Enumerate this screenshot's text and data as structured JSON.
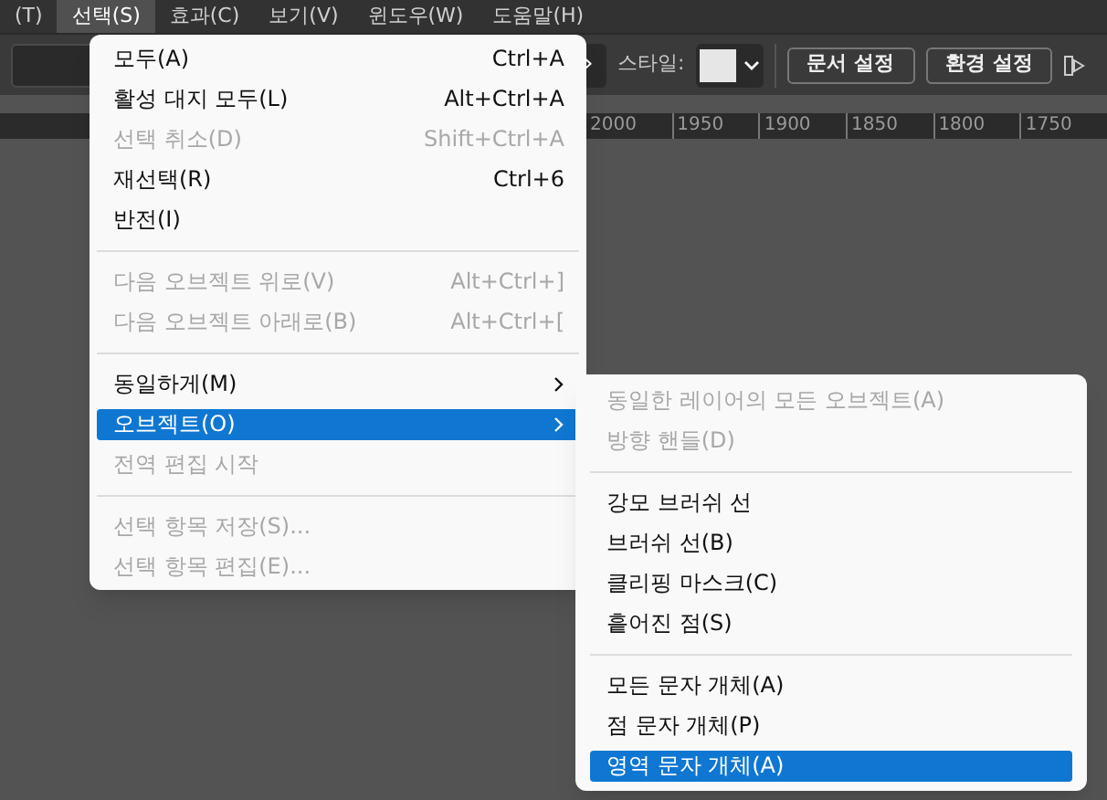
{
  "menu_bar": [
    {
      "label": "(T)",
      "selected": false
    },
    {
      "label": "선택(S)",
      "selected": true
    },
    {
      "label": "효과(C)",
      "selected": false
    },
    {
      "label": "보기(V)",
      "selected": false
    },
    {
      "label": "윈도우(W)",
      "selected": false
    },
    {
      "label": "도움말(H)",
      "selected": false
    }
  ],
  "toolbar": {
    "next_button": "›",
    "style_label": "스타일:",
    "buttons": [
      "문서 설정",
      "환경 설정"
    ]
  },
  "ruler": {
    "labels": [
      "2000",
      "1950",
      "1900",
      "1850",
      "1800",
      "1750"
    ]
  },
  "menu": [
    {
      "kind": "item",
      "label": "모두(A)",
      "shortcut": "Ctrl+A",
      "disabled": false,
      "selected": false,
      "submenu": false
    },
    {
      "kind": "item",
      "label": "활성 대지 모두(L)",
      "shortcut": "Alt+Ctrl+A",
      "disabled": false,
      "selected": false,
      "submenu": false
    },
    {
      "kind": "item",
      "label": "선택 취소(D)",
      "shortcut": "Shift+Ctrl+A",
      "disabled": true,
      "selected": false,
      "submenu": false
    },
    {
      "kind": "item",
      "label": "재선택(R)",
      "shortcut": "Ctrl+6",
      "disabled": false,
      "selected": false,
      "submenu": false
    },
    {
      "kind": "item",
      "label": "반전(I)",
      "disabled": false,
      "selected": false,
      "submenu": false
    },
    {
      "kind": "separator"
    },
    {
      "kind": "item",
      "label": "다음 오브젝트 위로(V)",
      "shortcut": "Alt+Ctrl+]",
      "disabled": true,
      "selected": false,
      "submenu": false
    },
    {
      "kind": "item",
      "label": "다음 오브젝트 아래로(B)",
      "shortcut": "Alt+Ctrl+[",
      "disabled": true,
      "selected": false,
      "submenu": false
    },
    {
      "kind": "separator"
    },
    {
      "kind": "item",
      "label": "동일하게(M)",
      "disabled": false,
      "selected": false,
      "submenu": true
    },
    {
      "kind": "item",
      "label": "오브젝트(O)",
      "disabled": false,
      "selected": true,
      "submenu": true
    },
    {
      "kind": "item",
      "label": "전역 편집 시작",
      "disabled": true,
      "selected": false,
      "submenu": false
    },
    {
      "kind": "separator"
    },
    {
      "kind": "item",
      "label": "선택 항목 저장(S)...",
      "disabled": true,
      "selected": false,
      "submenu": false
    },
    {
      "kind": "item",
      "label": "선택 항목 편집(E)...",
      "disabled": true,
      "selected": false,
      "submenu": false
    }
  ],
  "submenu": [
    {
      "kind": "item",
      "label": "동일한 레이어의 모든 오브젝트(A)",
      "disabled": true,
      "selected": false
    },
    {
      "kind": "item",
      "label": "방향 핸들(D)",
      "disabled": true,
      "selected": false
    },
    {
      "kind": "separator"
    },
    {
      "kind": "item",
      "label": "강모 브러쉬 선",
      "disabled": false,
      "selected": false
    },
    {
      "kind": "item",
      "label": "브러쉬 선(B)",
      "disabled": false,
      "selected": false
    },
    {
      "kind": "item",
      "label": "클리핑 마스크(C)",
      "disabled": false,
      "selected": false
    },
    {
      "kind": "item",
      "label": "흩어진 점(S)",
      "disabled": false,
      "selected": false
    },
    {
      "kind": "separator"
    },
    {
      "kind": "item",
      "label": "모든 문자 개체(A)",
      "disabled": false,
      "selected": false
    },
    {
      "kind": "item",
      "label": "점 문자 개체(P)",
      "disabled": false,
      "selected": false
    },
    {
      "kind": "item",
      "label": "영역 문자 개체(A)",
      "disabled": false,
      "selected": true
    }
  ]
}
